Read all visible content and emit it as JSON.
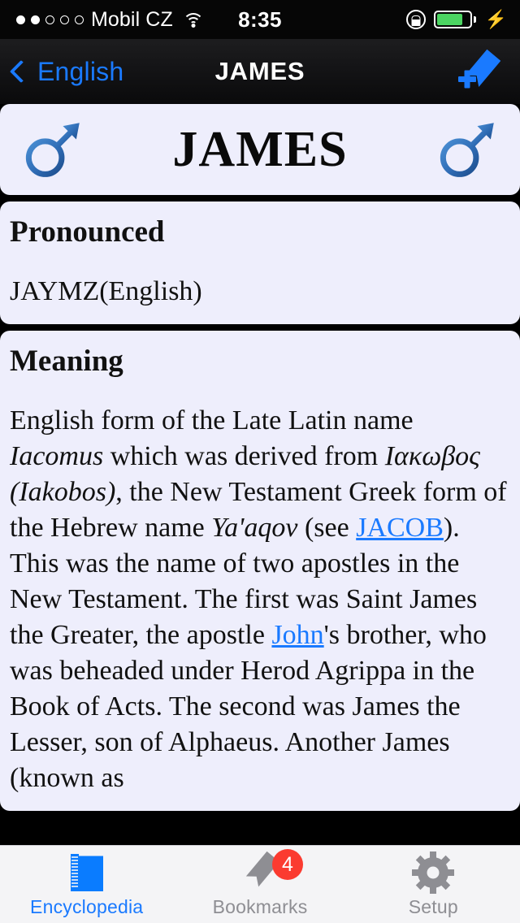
{
  "status_bar": {
    "carrier": "Mobil CZ",
    "signal_dots_filled": 2,
    "signal_dots_total": 5,
    "time": "8:35",
    "wifi_icon": "wifi-icon",
    "rotation_lock_icon": "rotation-lock-icon",
    "battery_icon": "battery-icon",
    "battery_level_percent": 80,
    "charging_icon": "lightning-bolt-icon",
    "battery_color": "#4cd562"
  },
  "nav_bar": {
    "back_label": "English",
    "back_icon": "chevron-left-icon",
    "title": "JAMES",
    "action_icon": "add-bookmark-icon",
    "accent_color": "#1a7aff"
  },
  "name_card": {
    "name": "JAMES",
    "gender_icon_left": "male-gender-icon",
    "gender_icon_right": "male-gender-icon",
    "gender": "male",
    "card_color": "#eeeefc"
  },
  "sections": [
    {
      "heading": "Pronounced",
      "body_html": "JAYMZ(English)"
    },
    {
      "heading": "Meaning",
      "body_html": "English form of the Late Latin name <i>Iacomus</i> which was derived from <i>Ιακωβος (Iakobos)</i>, the New Testament Greek form of the Hebrew name <i>Ya'aqov</i> (see <span class=\"lnk\" data-name=\"link-jacob\" data-interactable=\"true\">JACOB</span>). This was the name of two apostles in the New Testament. The first was Saint James the Greater, the apostle <span class=\"lnk\" data-name=\"link-john\" data-interactable=\"true\">John</span>'s brother, who was beheaded under Herod Agrippa in the Book of Acts. The second was James the Lesser, son of Alphaeus. Another James (known as"
    }
  ],
  "tab_bar": {
    "tabs": [
      {
        "label": "Encyclopedia",
        "icon": "book-icon",
        "active": true,
        "badge": ""
      },
      {
        "label": "Bookmarks",
        "icon": "bookmark-ribbon-icon",
        "active": false,
        "badge": "4"
      },
      {
        "label": "Setup",
        "icon": "gear-icon",
        "active": false,
        "badge": ""
      }
    ],
    "active_color": "#1a7aff",
    "inactive_color": "#8e8e93",
    "badge_color": "#fb3b30"
  }
}
